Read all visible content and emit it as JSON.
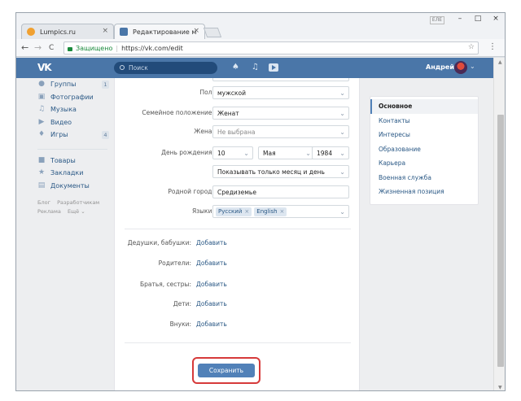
{
  "browser": {
    "tabs": [
      {
        "label": "Lumpics.ru",
        "favicon_color": "#f0a030"
      },
      {
        "label": "Редактирование моей с",
        "favicon_color": "#4a76a8"
      }
    ],
    "address": {
      "secure_label": "Защищено",
      "separator": "|",
      "url": "https://vk.com/edit"
    },
    "nav": {
      "back": "←",
      "forward": "→",
      "reload": "C"
    },
    "icons": {
      "star": "☆",
      "menu": "⋮",
      "close": "×"
    },
    "user_badge": "ЕЛЕ"
  },
  "vk_header": {
    "logo": "VK",
    "search_placeholder": "Поиск",
    "user_name": "Андрей",
    "caret": "⌄"
  },
  "left_nav": {
    "items": [
      {
        "label": "Группы",
        "icon": "groups-icon",
        "count": "1"
      },
      {
        "label": "Фотографии",
        "icon": "photos-icon",
        "count": ""
      },
      {
        "label": "Музыка",
        "icon": "music-icon",
        "count": ""
      },
      {
        "label": "Видео",
        "icon": "video-icon",
        "count": ""
      },
      {
        "label": "Игры",
        "icon": "games-icon",
        "count": "4"
      }
    ],
    "items2": [
      {
        "label": "Товары",
        "icon": "goods-icon"
      },
      {
        "label": "Закладки",
        "icon": "bookmarks-icon"
      },
      {
        "label": "Документы",
        "icon": "documents-icon"
      }
    ],
    "footer_line1": [
      "Блог",
      "Разработчикам"
    ],
    "footer_line2": [
      "Реклама",
      "Ещё ⌄"
    ]
  },
  "form": {
    "gender": {
      "label": "Пол:",
      "value": "мужской"
    },
    "marital": {
      "label": "Семейное положение:",
      "value": "Женат"
    },
    "wife": {
      "label": "Жена:",
      "value": "Не выбрана"
    },
    "birthday": {
      "label": "День рождения:",
      "day": "10",
      "month": "Мая",
      "year": "1984",
      "visibility": "Показывать только месяц и день"
    },
    "hometown": {
      "label": "Родной город:",
      "value": "Средиземье"
    },
    "languages": {
      "label": "Языки:",
      "tags": [
        "Русский",
        "English"
      ]
    },
    "relatives": [
      {
        "label": "Дедушки, бабушки:",
        "action": "Добавить"
      },
      {
        "label": "Родители:",
        "action": "Добавить"
      },
      {
        "label": "Братья, сестры:",
        "action": "Добавить"
      },
      {
        "label": "Дети:",
        "action": "Добавить"
      },
      {
        "label": "Внуки:",
        "action": "Добавить"
      }
    ],
    "save_label": "Сохранить"
  },
  "right_menu": {
    "items": [
      "Основное",
      "Контакты",
      "Интересы",
      "Образование",
      "Карьера",
      "Военная служба",
      "Жизненная позиция"
    ],
    "active": 0
  },
  "colors": {
    "vk_blue": "#4a76a8",
    "link": "#2a5885",
    "button": "#5181b8",
    "highlight": "#d63a3a"
  }
}
